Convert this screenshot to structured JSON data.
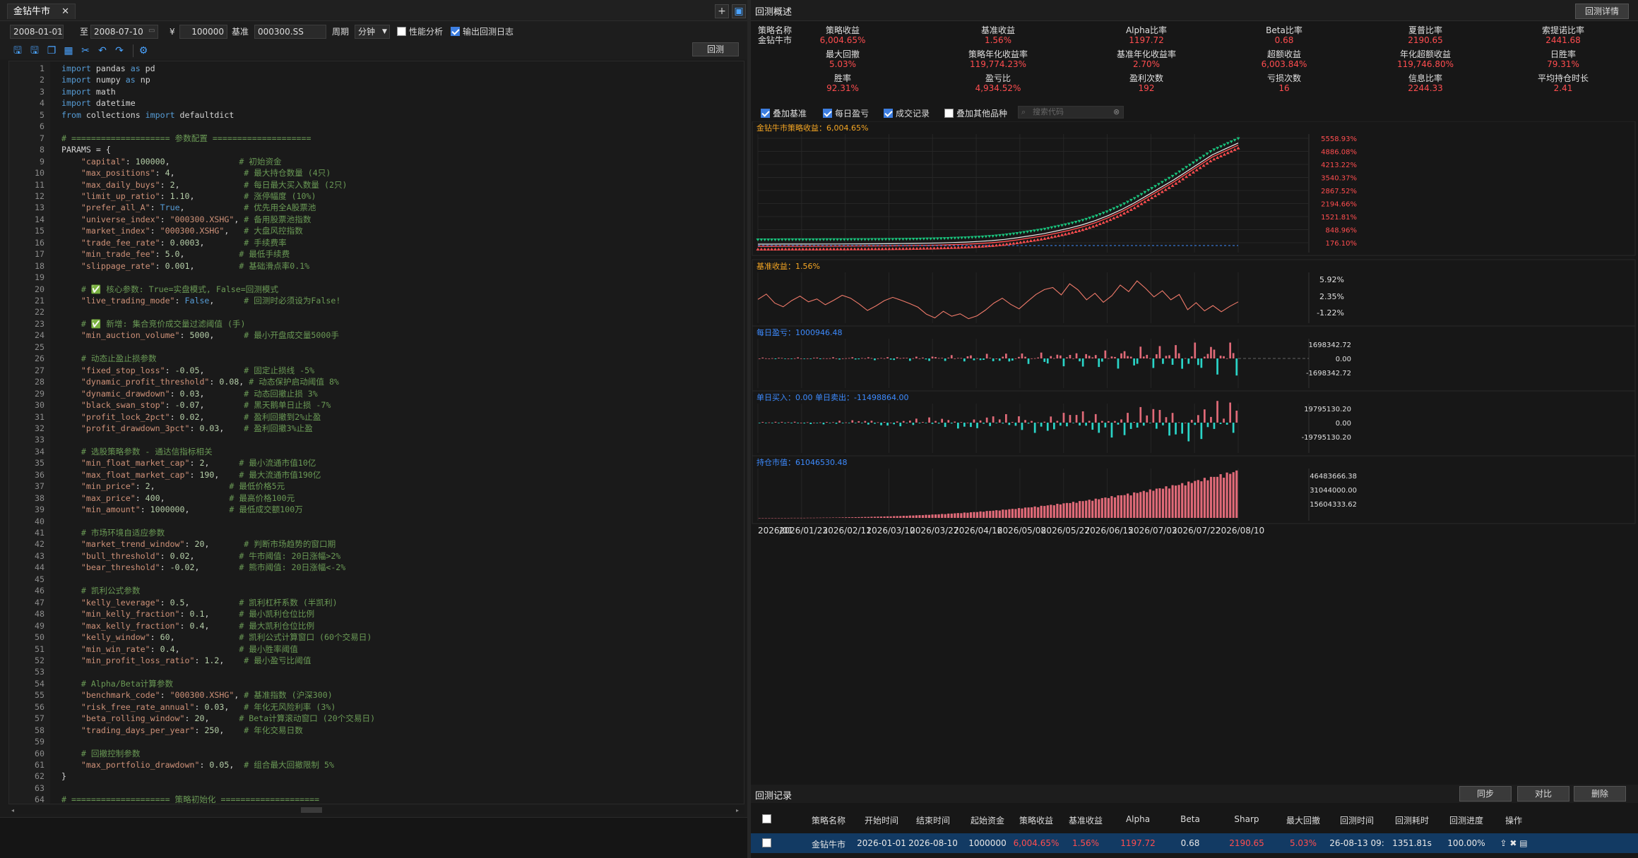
{
  "editor": {
    "tab_title": "金钻牛市",
    "tab_close": "✕",
    "add_button": "+",
    "layout_button": "▣",
    "start_date": "2008-01-01",
    "to_label": "至",
    "end_date": "2008-07-10",
    "currency_symbol": "¥",
    "capital": "100000",
    "benchmark_label": "基准",
    "benchmark_value": "000300.SS",
    "period_label": "周期",
    "period_value": "分钟",
    "perf_label": "性能分析",
    "log_label": "输出回测日志",
    "run_label": "回测",
    "lines": [
      {
        "n": "1",
        "html": "<span class='kw'>import</span> pandas <span class='kw'>as</span> pd"
      },
      {
        "n": "2",
        "html": "<span class='kw'>import</span> numpy <span class='kw'>as</span> np"
      },
      {
        "n": "3",
        "html": "<span class='kw'>import</span> math"
      },
      {
        "n": "4",
        "html": "<span class='kw'>import</span> datetime"
      },
      {
        "n": "5",
        "html": "<span class='kw'>from</span> collections <span class='kw'>import</span> defaultdict"
      },
      {
        "n": "6",
        "html": ""
      },
      {
        "n": "7",
        "html": "<span class='cm'># ==================== 参数配置 ====================</span>"
      },
      {
        "n": "8",
        "html": "PARAMS = {"
      },
      {
        "n": "9",
        "html": "    <span class='st'>\"capital\"</span>: <span class='nm'>100000</span>,              <span class='cm'># 初始资金</span>"
      },
      {
        "n": "10",
        "html": "    <span class='st'>\"max_positions\"</span>: <span class='nm'>4</span>,              <span class='cm'># 最大持仓数量 (4只)</span>"
      },
      {
        "n": "11",
        "html": "    <span class='st'>\"max_daily_buys\"</span>: <span class='nm'>2</span>,             <span class='cm'># 每日最大买入数量 (2只)</span>"
      },
      {
        "n": "12",
        "html": "    <span class='st'>\"limit_up_ratio\"</span>: <span class='nm'>1.10</span>,          <span class='cm'># 涨停幅度 (10%)</span>"
      },
      {
        "n": "13",
        "html": "    <span class='st'>\"prefer_all_A\"</span>: <span class='kw'>True</span>,            <span class='cm'># 优先用全A股票池</span>"
      },
      {
        "n": "14",
        "html": "    <span class='st'>\"universe_index\"</span>: <span class='st'>\"000300.XSHG\"</span>, <span class='cm'># 备用股票池指数</span>"
      },
      {
        "n": "15",
        "html": "    <span class='st'>\"market_index\"</span>: <span class='st'>\"000300.XSHG\"</span>,   <span class='cm'># 大盘风控指数</span>"
      },
      {
        "n": "16",
        "html": "    <span class='st'>\"trade_fee_rate\"</span>: <span class='nm'>0.0003</span>,        <span class='cm'># 手续费率</span>"
      },
      {
        "n": "17",
        "html": "    <span class='st'>\"min_trade_fee\"</span>: <span class='nm'>5.0</span>,           <span class='cm'># 最低手续费</span>"
      },
      {
        "n": "18",
        "html": "    <span class='st'>\"slippage_rate\"</span>: <span class='nm'>0.001</span>,         <span class='cm'># 基础滑点率0.1%</span>"
      },
      {
        "n": "19",
        "html": ""
      },
      {
        "n": "20",
        "html": "    <span class='cm'># ✅ 核心参数: True=实盘模式, False=回测模式</span>"
      },
      {
        "n": "21",
        "html": "    <span class='st'>\"live_trading_mode\"</span>: <span class='kw'>False</span>,      <span class='cm'># 回测时必须设为False!</span>"
      },
      {
        "n": "22",
        "html": ""
      },
      {
        "n": "23",
        "html": "    <span class='cm'># ✅ 新增: 集合竞价成交量过滤阈值 (手)</span>"
      },
      {
        "n": "24",
        "html": "    <span class='st'>\"min_auction_volume\"</span>: <span class='nm'>5000</span>,      <span class='cm'># 最小开盘成交量5000手</span>"
      },
      {
        "n": "25",
        "html": ""
      },
      {
        "n": "26",
        "html": "    <span class='cm'># 动态止盈止损参数</span>"
      },
      {
        "n": "27",
        "html": "    <span class='st'>\"fixed_stop_loss\"</span>: <span class='nm'>-0.05</span>,        <span class='cm'># 固定止损线 -5%</span>"
      },
      {
        "n": "28",
        "html": "    <span class='st'>\"dynamic_profit_threshold\"</span>: <span class='nm'>0.08</span>, <span class='cm'># 动态保护启动阈值 8%</span>"
      },
      {
        "n": "29",
        "html": "    <span class='st'>\"dynamic_drawdown\"</span>: <span class='nm'>0.03</span>,        <span class='cm'># 动态回撤止损 3%</span>"
      },
      {
        "n": "30",
        "html": "    <span class='st'>\"black_swan_stop\"</span>: <span class='nm'>-0.07</span>,        <span class='cm'># 黑天鹅单日止损 -7%</span>"
      },
      {
        "n": "31",
        "html": "    <span class='st'>\"profit_lock_2pct\"</span>: <span class='nm'>0.02</span>,        <span class='cm'># 盈利回撤到2%止盈</span>"
      },
      {
        "n": "32",
        "html": "    <span class='st'>\"profit_drawdown_3pct\"</span>: <span class='nm'>0.03</span>,    <span class='cm'># 盈利回撤3%止盈</span>"
      },
      {
        "n": "33",
        "html": ""
      },
      {
        "n": "34",
        "html": "    <span class='cm'># 选股策略参数 - 通达信指标相关</span>"
      },
      {
        "n": "35",
        "html": "    <span class='st'>\"min_float_market_cap\"</span>: <span class='nm'>2</span>,      <span class='cm'># 最小流通市值10亿</span>"
      },
      {
        "n": "36",
        "html": "    <span class='st'>\"max_float_market_cap\"</span>: <span class='nm'>190</span>,    <span class='cm'># 最大流通市值190亿</span>"
      },
      {
        "n": "37",
        "html": "    <span class='st'>\"min_price\"</span>: <span class='nm'>2</span>,               <span class='cm'># 最低价格5元</span>"
      },
      {
        "n": "38",
        "html": "    <span class='st'>\"max_price\"</span>: <span class='nm'>400</span>,             <span class='cm'># 最高价格100元</span>"
      },
      {
        "n": "39",
        "html": "    <span class='st'>\"min_amount\"</span>: <span class='nm'>1000000</span>,        <span class='cm'># 最低成交额100万</span>"
      },
      {
        "n": "40",
        "html": ""
      },
      {
        "n": "41",
        "html": "    <span class='cm'># 市场环境自适应参数</span>"
      },
      {
        "n": "42",
        "html": "    <span class='st'>\"market_trend_window\"</span>: <span class='nm'>20</span>,       <span class='cm'># 判断市场趋势的窗口期</span>"
      },
      {
        "n": "43",
        "html": "    <span class='st'>\"bull_threshold\"</span>: <span class='nm'>0.02</span>,         <span class='cm'># 牛市阈值: 20日涨幅>2%</span>"
      },
      {
        "n": "44",
        "html": "    <span class='st'>\"bear_threshold\"</span>: <span class='nm'>-0.02</span>,        <span class='cm'># 熊市阈值: 20日涨幅<-2%</span>"
      },
      {
        "n": "45",
        "html": ""
      },
      {
        "n": "46",
        "html": "    <span class='cm'># 凯利公式参数</span>"
      },
      {
        "n": "47",
        "html": "    <span class='st'>\"kelly_leverage\"</span>: <span class='nm'>0.5</span>,          <span class='cm'># 凯利杠杆系数 (半凯利)</span>"
      },
      {
        "n": "48",
        "html": "    <span class='st'>\"min_kelly_fraction\"</span>: <span class='nm'>0.1</span>,      <span class='cm'># 最小凯利仓位比例</span>"
      },
      {
        "n": "49",
        "html": "    <span class='st'>\"max_kelly_fraction\"</span>: <span class='nm'>0.4</span>,      <span class='cm'># 最大凯利仓位比例</span>"
      },
      {
        "n": "50",
        "html": "    <span class='st'>\"kelly_window\"</span>: <span class='nm'>60</span>,             <span class='cm'># 凯利公式计算窗口 (60个交易日)</span>"
      },
      {
        "n": "51",
        "html": "    <span class='st'>\"min_win_rate\"</span>: <span class='nm'>0.4</span>,            <span class='cm'># 最小胜率阈值</span>"
      },
      {
        "n": "52",
        "html": "    <span class='st'>\"min_profit_loss_ratio\"</span>: <span class='nm'>1.2</span>,    <span class='cm'># 最小盈亏比阈值</span>"
      },
      {
        "n": "53",
        "html": ""
      },
      {
        "n": "54",
        "html": "    <span class='cm'># Alpha/Beta计算参数</span>"
      },
      {
        "n": "55",
        "html": "    <span class='st'>\"benchmark_code\"</span>: <span class='st'>\"000300.XSHG\"</span>, <span class='cm'># 基准指数 (沪深300)</span>"
      },
      {
        "n": "56",
        "html": "    <span class='st'>\"risk_free_rate_annual\"</span>: <span class='nm'>0.03</span>,   <span class='cm'># 年化无风险利率 (3%)</span>"
      },
      {
        "n": "57",
        "html": "    <span class='st'>\"beta_rolling_window\"</span>: <span class='nm'>20</span>,      <span class='cm'># Beta计算滚动窗口 (20个交易日)</span>"
      },
      {
        "n": "58",
        "html": "    <span class='st'>\"trading_days_per_year\"</span>: <span class='nm'>250</span>,    <span class='cm'># 年化交易日数</span>"
      },
      {
        "n": "59",
        "html": ""
      },
      {
        "n": "60",
        "html": "    <span class='cm'># 回撤控制参数</span>"
      },
      {
        "n": "61",
        "html": "    <span class='st'>\"max_portfolio_drawdown\"</span>: <span class='nm'>0.05</span>,  <span class='cm'># 组合最大回撤限制 5%</span>"
      },
      {
        "n": "62",
        "html": "}"
      },
      {
        "n": "63",
        "html": ""
      },
      {
        "n": "64",
        "html": "<span class='cm'># ==================== 策略初始化 ====================</span>"
      }
    ]
  },
  "backtest": {
    "title": "回测概述",
    "detail_button": "回测详情",
    "strategy_name_label": "策略名称",
    "strategy_name": "金钻牛市",
    "metrics": [
      {
        "label": "策略收益",
        "value": "6,004.65%"
      },
      {
        "label": "基准收益",
        "value": "1.56%"
      },
      {
        "label": "Alpha比率",
        "value": "1197.72"
      },
      {
        "label": "Beta比率",
        "value": "0.68"
      },
      {
        "label": "夏普比率",
        "value": "2190.65"
      },
      {
        "label": "索提诺比率",
        "value": "2441.68"
      },
      {
        "label": "最大回撤",
        "value": "5.03%"
      },
      {
        "label": "策略年化收益率",
        "value": "119,774.23%"
      },
      {
        "label": "基准年化收益率",
        "value": "2.70%"
      },
      {
        "label": "超额收益",
        "value": "6,003.84%"
      },
      {
        "label": "年化超额收益",
        "value": "119,746.80%"
      },
      {
        "label": "日胜率",
        "value": "79.31%"
      },
      {
        "label": "胜率",
        "value": "92.31%"
      },
      {
        "label": "盈亏比",
        "value": "4,934.52%"
      },
      {
        "label": "盈利次数",
        "value": "192"
      },
      {
        "label": "亏损次数",
        "value": "16"
      },
      {
        "label": "信息比率",
        "value": "2244.33"
      },
      {
        "label": "平均持仓时长",
        "value": "2.41"
      }
    ],
    "options": {
      "overlay_benchmark": "叠加基准",
      "daily_pnl": "每日盈亏",
      "trades": "成交记录",
      "overlay_others": "叠加其他品种",
      "search_placeholder": "搜索代码"
    },
    "colors": {
      "red": "#ff4d4f",
      "green": "#19c37d",
      "cyan": "#2ad4c7",
      "orange": "#f5a623",
      "blue": "#3d8bff"
    }
  },
  "chart_data": [
    {
      "type": "line",
      "title": "金钻牛市策略收益：6,004.65%",
      "ytick_labels": [
        "5558.93%",
        "4886.08%",
        "4213.22%",
        "3540.37%",
        "2867.52%",
        "2194.66%",
        "1521.81%",
        "848.96%",
        "176.10%"
      ],
      "series": [
        {
          "name": "策略收益",
          "values": [
            0,
            2,
            3,
            5,
            6,
            8,
            10,
            13,
            15,
            20,
            25,
            32,
            40,
            55,
            70,
            95,
            120,
            160,
            210,
            280,
            380,
            500,
            620,
            780,
            950,
            1150,
            1400,
            1700,
            2050,
            2450,
            2900,
            3350,
            3800,
            4300,
            4800,
            5300,
            5650,
            6004.65
          ]
        },
        {
          "name": "基准收益",
          "values": [
            0,
            0,
            0,
            0,
            0,
            0,
            0,
            0,
            0,
            0,
            0,
            0,
            0,
            0,
            0,
            0,
            0,
            0,
            0,
            0,
            0,
            0,
            0,
            0,
            0,
            0,
            0,
            0,
            0,
            0,
            0,
            0,
            0,
            0,
            0,
            0,
            0,
            0
          ]
        }
      ],
      "ylim": [
        0,
        6200
      ]
    },
    {
      "type": "line",
      "title": "基准收益：1.56%",
      "ytick_labels": [
        "5.92%",
        "2.35%",
        "-1.22%"
      ],
      "values": [
        2.1,
        3.4,
        1.2,
        0.3,
        1.8,
        2.9,
        1.5,
        2.2,
        0.8,
        1.9,
        3.1,
        2.4,
        1.0,
        -0.6,
        0.5,
        1.8,
        2.6,
        1.9,
        1.1,
        0.2,
        -1.5,
        -2.4,
        -0.8,
        -2.0,
        -1.4,
        -2.6,
        -1.9,
        -0.5,
        1.2,
        2.4,
        0.9,
        -0.2,
        1.6,
        3.3,
        4.5,
        5.0,
        3.2,
        5.9,
        4.4,
        2.0,
        3.6,
        1.4,
        3.0,
        5.6,
        4.0,
        6.6,
        4.8,
        2.7,
        4.2,
        2.0,
        3.3,
        -0.4,
        1.3,
        -0.7,
        0.6,
        -0.9,
        0.4,
        1.5
      ],
      "ylim": [
        -3,
        8
      ]
    },
    {
      "type": "bar",
      "title": "每日盈亏：1000946.48",
      "ytick_labels": [
        "1698342.72",
        "0.00",
        "-1698342.72"
      ],
      "ylim": [
        -2200000,
        3000000
      ]
    },
    {
      "type": "bar",
      "title": "单日买入：0.00 单日卖出：-11498864.00",
      "ytick_labels": [
        "19795130.20",
        "0.00",
        "-19795130.20"
      ],
      "ylim": [
        -30000000,
        30000000
      ]
    },
    {
      "type": "bar",
      "title": "持仓市值：61046530.48",
      "ytick_labels": [
        "46483666.38",
        "31044000.00",
        "15604333.62"
      ],
      "ylim": [
        0,
        62000000
      ]
    }
  ],
  "x_dates": [
    "2026/01",
    "2026/01/23",
    "2026/02/11",
    "2026/03/10",
    "2026/03/27",
    "2026/04/16",
    "2026/05/08",
    "2026/05/27",
    "2026/06/15",
    "2026/07/03",
    "2026/07/22",
    "2026/08/10"
  ],
  "records": {
    "title": "回测记录",
    "sync": "同步",
    "compare": "对比",
    "delete": "删除",
    "headers": [
      "策略名称",
      "开始时间",
      "结束时间",
      "起始资金",
      "策略收益",
      "基准收益",
      "Alpha",
      "Beta",
      "Sharp",
      "最大回撤",
      "回测时间",
      "回测耗时",
      "回测进度",
      "操作"
    ],
    "row": [
      "金钻牛市",
      "2026-01-01",
      "2026-08-10",
      "1000000",
      "6,004.65%",
      "1.56%",
      "1197.72",
      "0.68",
      "2190.65",
      "5.03%",
      "26-08-13 09:",
      "1351.81s",
      "100.00%",
      "⇪ ✖ ▤"
    ]
  }
}
